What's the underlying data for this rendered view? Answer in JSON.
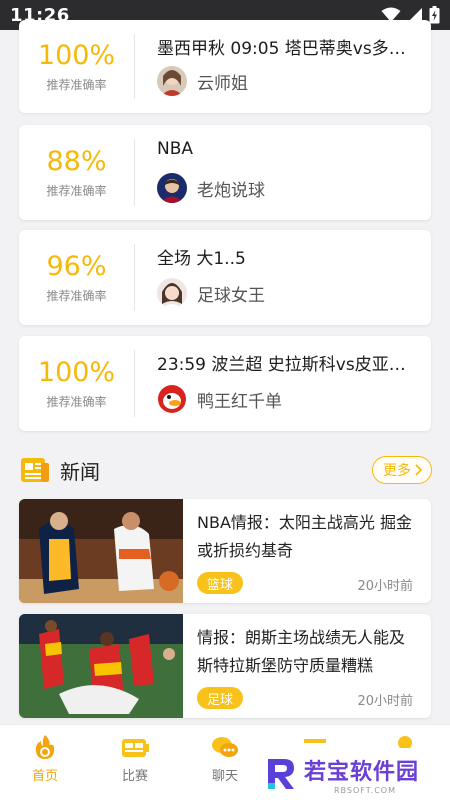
{
  "status_bar": {
    "time": "11:26"
  },
  "tips": [
    {
      "rate": "100%",
      "rate_label": "推荐准确率",
      "title": "墨西甲秋 09:05 塔巴蒂奥vs多…",
      "author": "云师姐"
    },
    {
      "rate": "88%",
      "rate_label": "推荐准确率",
      "title": "NBA",
      "author": "老炮说球"
    },
    {
      "rate": "96%",
      "rate_label": "推荐准确率",
      "title": "全场 大1..5",
      "author": "足球女王"
    },
    {
      "rate": "100%",
      "rate_label": "推荐准确率",
      "title": "23:59 波兰超 史拉斯科vs皮亚…",
      "author": "鸭王红千单"
    }
  ],
  "news_section": {
    "title": "新闻",
    "more_label": "更多"
  },
  "news": [
    {
      "headline": "NBA情报：太阳主战高光 掘金或折损约基奇",
      "tag": "篮球",
      "time": "20小时前"
    },
    {
      "headline": "情报：朗斯主场战绩无人能及 斯特拉斯堡防守质量糟糕",
      "tag": "足球",
      "time": "20小时前"
    }
  ],
  "bottom_nav": {
    "items": [
      {
        "label": "首页",
        "icon": "home-fire-icon",
        "active": true
      },
      {
        "label": "比赛",
        "icon": "match-icon",
        "active": false
      },
      {
        "label": "聊天",
        "icon": "chat-icon",
        "active": false
      },
      {
        "label": "",
        "icon": "expert-icon",
        "active": false
      },
      {
        "label": "",
        "icon": "profile-icon",
        "active": false
      }
    ]
  },
  "watermark": {
    "text": "若宝软件园",
    "sub": "RBSOFT.COM"
  },
  "colors": {
    "accent": "#f6b90a",
    "tag": "#f9c21a",
    "status_bar": "#2c2c2e"
  }
}
